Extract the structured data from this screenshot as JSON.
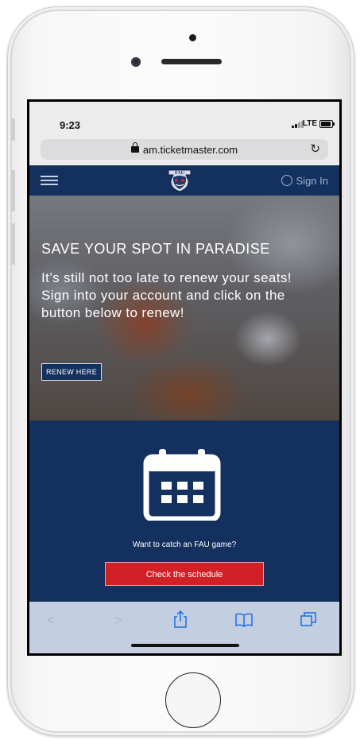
{
  "status_bar": {
    "time": "9:23",
    "network": "LTE"
  },
  "browser": {
    "url": "am.ticketmaster.com",
    "lock_icon": "lock-icon",
    "reload_icon": "reload-icon"
  },
  "navbar": {
    "logo_text": "FAU",
    "signin_label": "Sign In",
    "menu_icon": "hamburger-icon",
    "user_icon": "user-icon"
  },
  "hero": {
    "title": "SAVE YOUR SPOT IN PARADISE",
    "text": "It’s still not too late to renew your seats! Sign into your account and click on the button below to renew!",
    "renew_button": "RENEW HERE"
  },
  "schedule": {
    "prompt": "Want to catch an FAU game?",
    "button_label": "Check the schedule",
    "icon": "calendar-icon"
  },
  "toolbar": {
    "back_icon": "back-icon",
    "forward_icon": "forward-icon",
    "share_icon": "share-icon",
    "bookmarks_icon": "book-icon",
    "tabs_icon": "tabs-icon"
  },
  "colors": {
    "navy": "#14305e",
    "red": "#d22027",
    "toolbar": "#c3cfe0",
    "accent_blue": "#1a6ee0"
  }
}
